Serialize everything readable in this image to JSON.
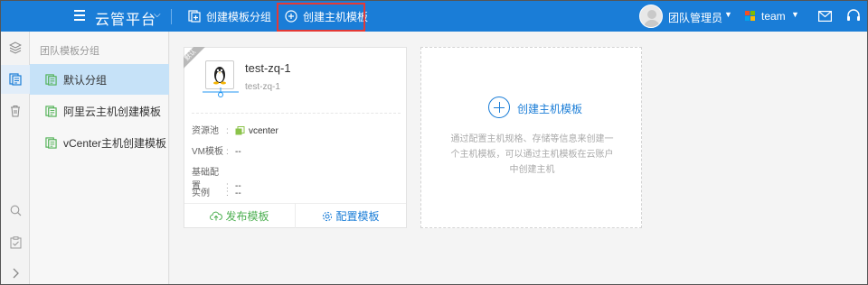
{
  "colors": {
    "primary": "#1a7dd7",
    "highlight": "#e53935",
    "publish": "#4caf50"
  },
  "topbar": {
    "app_title": "云管平台",
    "create_group_label": "创建模板分组",
    "create_template_label": "创建主机模板",
    "user_name": "团队管理员",
    "team_name": "team"
  },
  "sidebar": {
    "title": "团队模板分组",
    "items": [
      {
        "label": "默认分组",
        "active": true
      },
      {
        "label": "阿里云主机创建模板",
        "active": false
      },
      {
        "label": "vCenter主机创建模板",
        "active": false
      }
    ]
  },
  "card": {
    "ribbon": "默认",
    "name": "test-zq-1",
    "subname": "test-zq-1",
    "fields": [
      {
        "key": "资源池",
        "colon": ":",
        "value": "vcenter"
      },
      {
        "key": "VM模板",
        "colon": ":",
        "value": "--"
      },
      {
        "key": "基础配置",
        "colon": ":",
        "value": "--"
      },
      {
        "key": "实例",
        "colon": ":",
        "value": "--"
      }
    ],
    "publish_label": "发布模板",
    "configure_label": "配置模板"
  },
  "new_card": {
    "label": "创建主机模板",
    "description": "通过配置主机规格、存储等信息来创建一个主机模板，可以通过主机模板在云账户中创建主机"
  }
}
